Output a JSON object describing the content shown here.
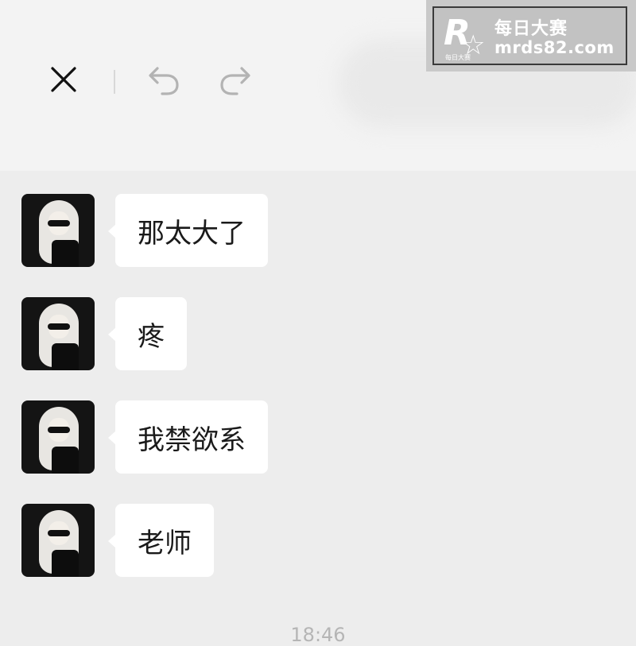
{
  "toolbar": {
    "close_icon": "close-icon",
    "undo_icon": "undo-icon",
    "redo_icon": "redo-icon"
  },
  "watermark": {
    "logo_letter": "R",
    "logo_small": "每日大赛",
    "title": "每日大赛",
    "url": "mrds82.com"
  },
  "messages": [
    {
      "text": "那太大了"
    },
    {
      "text": "疼"
    },
    {
      "text": "我禁欲系"
    },
    {
      "text": "老师"
    }
  ],
  "timestamp": "18:46",
  "colors": {
    "background": "#ededed",
    "topbar": "#f3f3f3",
    "bubble": "#ffffff",
    "icon_dark": "#111111",
    "icon_gray": "#b3b3b3"
  }
}
